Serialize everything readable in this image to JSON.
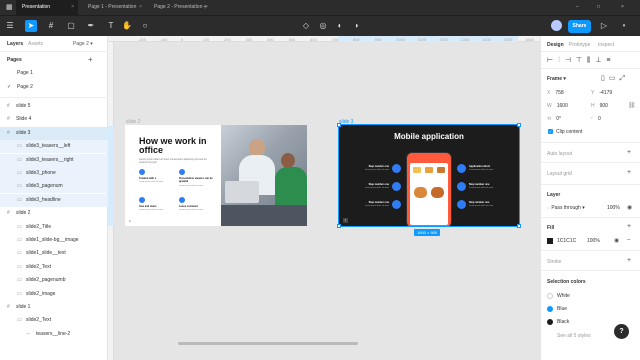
{
  "tabs": [
    {
      "label": "Presentation",
      "active": true
    },
    {
      "label": "Page 1 - Presentation",
      "active": false
    },
    {
      "label": "Page 2 - Presentation",
      "active": false
    }
  ],
  "share_label": "Share",
  "left": {
    "tab_layers": "Layers",
    "tab_assets": "Assets",
    "page_selector": "Page 2",
    "pages_header": "Pages",
    "pages": [
      "Page 1",
      "Page 2"
    ],
    "layers": [
      {
        "label": "slide 5",
        "level": 0,
        "state": ""
      },
      {
        "label": "Slide 4",
        "level": 0,
        "state": ""
      },
      {
        "label": "slide 3",
        "level": 0,
        "state": "selected"
      },
      {
        "label": "slide3_teasers__left",
        "level": 1,
        "state": "child"
      },
      {
        "label": "slide3_teasers__right",
        "level": 1,
        "state": "child"
      },
      {
        "label": "slide3_phone",
        "level": 1,
        "state": "child"
      },
      {
        "label": "slide3_pagenum",
        "level": 1,
        "state": "child"
      },
      {
        "label": "slide3_headline",
        "level": 1,
        "state": "child"
      },
      {
        "label": "slide 2",
        "level": 0,
        "state": ""
      },
      {
        "label": "slide2_Title",
        "level": 1,
        "state": ""
      },
      {
        "label": "slide1_slide-bg__image",
        "level": 1,
        "state": ""
      },
      {
        "label": "slide1_slide__text",
        "level": 1,
        "state": ""
      },
      {
        "label": "slide2_Text",
        "level": 1,
        "state": ""
      },
      {
        "label": "slide2_pagenumb",
        "level": 1,
        "state": ""
      },
      {
        "label": "slide2_image",
        "level": 1,
        "state": ""
      },
      {
        "label": "slide 1",
        "level": 0,
        "state": ""
      },
      {
        "label": "slide2_Text",
        "level": 1,
        "state": ""
      },
      {
        "label": "teasers__line-2",
        "level": 2,
        "state": ""
      }
    ]
  },
  "canvas": {
    "ruler_marks": [
      "-200",
      "-100",
      "0",
      "100",
      "200",
      "300",
      "400",
      "500",
      "600",
      "700",
      "800",
      "900",
      "1000",
      "1100",
      "1200",
      "1300",
      "1400",
      "1500",
      "1600"
    ],
    "slide2_label": "slide 2",
    "slide3_label": "slide 3",
    "size_badge": "1600 × 900",
    "slide2": {
      "title": "How we work in office",
      "body": "Lorem ipsum dolor sit amet consectetur adipiscing elit sed do eiusmod tempor",
      "features": [
        {
          "title": "Created with ♥",
          "text": "Lorem ipsum dolor sit amet"
        },
        {
          "title": "Presentation viewers can be grateful",
          "text": "Lorem ipsum dolor sit amet"
        },
        {
          "title": "Like and share",
          "text": "Lorem ipsum dolor sit amet"
        },
        {
          "title": "Leave comment",
          "text": "Lorem ipsum dolor sit amet"
        }
      ],
      "page_number": "2"
    },
    "slide3": {
      "title": "Mobile application",
      "left_items": [
        {
          "title": "Step number one",
          "text": "Lorem ipsum dolor sit amet"
        },
        {
          "title": "Step number one",
          "text": "Lorem ipsum dolor sit amet"
        },
        {
          "title": "Step number one",
          "text": "Lorem ipsum dolor sit amet"
        }
      ],
      "right_items": [
        {
          "title": "Application direct",
          "text": "Lorem ipsum dolor sit amet"
        },
        {
          "title": "Step number one",
          "text": "Lorem ipsum dolor sit amet"
        },
        {
          "title": "Step number one",
          "text": "Lorem ipsum dolor sit amet"
        }
      ],
      "page_number": "3"
    }
  },
  "right": {
    "tabs": [
      "Design",
      "Prototype",
      "Inspect"
    ],
    "frame_label": "Frame",
    "x": "758",
    "y": "-4179",
    "w": "1600",
    "h": "900",
    "rotation": "0°",
    "radius": "0",
    "clip_content": "Clip content",
    "auto_layout": "Auto layout",
    "layout_grid": "Layout grid",
    "layer_header": "Layer",
    "blend": "Pass through",
    "opacity": "100%",
    "fill_header": "Fill",
    "fill_hex": "1C1C1C",
    "fill_opacity": "100%",
    "stroke_header": "Stroke",
    "selection_colors_header": "Selection colors",
    "selection_colors": [
      {
        "name": "White",
        "hex": "#ffffff"
      },
      {
        "name": "Blue",
        "hex": "#0d99ff"
      },
      {
        "name": "Black",
        "hex": "#1c1c1c"
      }
    ],
    "see_all": "See all 5 styles",
    "help": "?"
  },
  "colors": {
    "accent": "#0d99ff",
    "slide3_bg": "#1c1c1c",
    "phone_orange": "#ff5a3c",
    "blue_icon": "#2f7df6"
  }
}
